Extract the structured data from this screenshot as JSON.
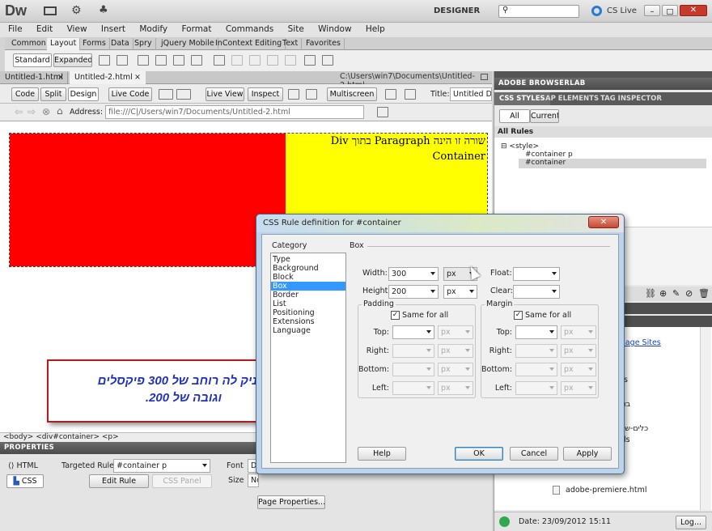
{
  "app": {
    "logo": "Dw",
    "workspace": "DESIGNER",
    "cs_live": "CS Live",
    "menu": [
      "File",
      "Edit",
      "View",
      "Insert",
      "Modify",
      "Format",
      "Commands",
      "Site",
      "Window",
      "Help"
    ]
  },
  "insert_tabs": [
    "Common",
    "Layout",
    "Forms",
    "Data",
    "Spry",
    "jQuery Mobile",
    "InContext Editing",
    "Text",
    "Favorites"
  ],
  "layout_buttons": {
    "standard": "Standard",
    "expanded": "Expanded"
  },
  "doc_tabs": [
    "Untitled-1.html",
    "Untitled-2.html"
  ],
  "doc_path": "C:\\Users\\win7\\Documents\\Untitled-2.html",
  "doc_toolbar": {
    "code": "Code",
    "split": "Split",
    "design": "Design",
    "live_code": "Live Code",
    "live_view": "Live View",
    "inspect": "Inspect",
    "multiscreen": "Multiscreen",
    "title_label": "Title:",
    "title_value": "Untitled Docu"
  },
  "address": {
    "label": "Address:",
    "value": "file:///C|/Users/win7/Documents/Untitled-2.html"
  },
  "canvas": {
    "paragraph_text": "שורה זו הינה Paragraph בתוך Div Container",
    "red": "#ff0000",
    "yellow": "#ffff00"
  },
  "callout": {
    "line1": "נעניק לה רוחב של 300 פיקסלים",
    "line2": "וגובה של 200."
  },
  "tag_selector": "<body> <div#container> <p>",
  "properties": {
    "header": "PROPERTIES",
    "html": "HTML",
    "css": "CSS",
    "targeted_rule_label": "Targeted Rule",
    "targeted_rule_value": "#container p",
    "edit_rule": "Edit Rule",
    "css_panel": "CSS Panel",
    "font_label": "Font",
    "font_value": "De",
    "size_label": "Size",
    "size_value": "No",
    "page_properties": "Page Properties..."
  },
  "right_panel": {
    "browserlab": "ADOBE BROWSERLAB",
    "tabs": [
      "CSS STYLES",
      "AP ELEMENTS",
      "TAG INSPECTOR"
    ],
    "all": "All",
    "current": "Current",
    "all_rules": "All Rules",
    "rules": [
      "<style>",
      "#container p",
      "#container"
    ],
    "manage_sites": "anage Sites",
    "files": [
      "s",
      "בו",
      "כלים-שימו",
      "ls"
    ],
    "file_item": "adobe-premiere.html",
    "date": "Date: 23/09/2012 15:11",
    "log": "Log..."
  },
  "dialog": {
    "title": "CSS Rule definition for #container",
    "category_header": "Category",
    "categories": [
      "Type",
      "Background",
      "Block",
      "Box",
      "Border",
      "List",
      "Positioning",
      "Extensions",
      "Language"
    ],
    "selected_category": "Box",
    "section": "Box",
    "width_label": "Width:",
    "width_value": "300",
    "width_unit": "px",
    "height_label": "Height:",
    "height_value": "200",
    "height_unit": "px",
    "float_label": "Float:",
    "clear_label": "Clear:",
    "padding": "Padding",
    "margin": "Margin",
    "same_for_all": "Same for all",
    "sides": [
      "Top:",
      "Right:",
      "Bottom:",
      "Left:"
    ],
    "px": "px",
    "help": "Help",
    "ok": "OK",
    "cancel": "Cancel",
    "apply": "Apply"
  }
}
